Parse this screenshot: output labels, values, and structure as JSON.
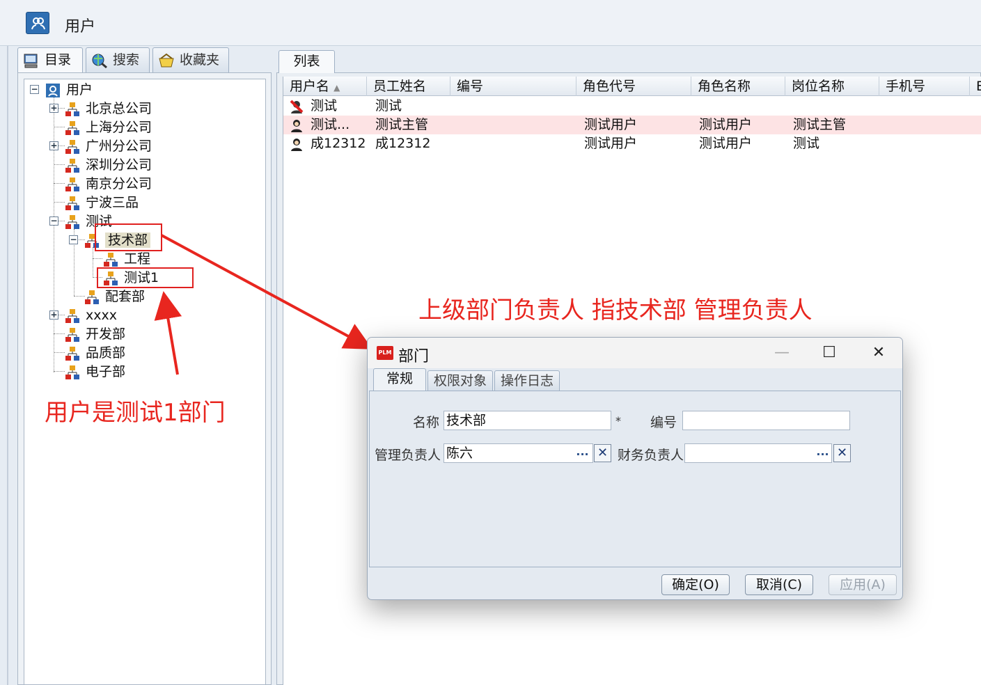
{
  "window": {
    "title": "用户"
  },
  "left_panel": {
    "tabs": [
      {
        "label": "目录",
        "icon": "computer-icon"
      },
      {
        "label": "搜索",
        "icon": "search-globe-icon"
      },
      {
        "label": "收藏夹",
        "icon": "favorites-icon"
      }
    ],
    "tree": {
      "root": "用户",
      "items": [
        "北京总公司",
        "上海分公司",
        "广州分公司",
        "深圳分公司",
        "南京分公司",
        "宁波三品",
        "测试",
        "技术部",
        "工程",
        "测试1",
        "配套部",
        "xxxx",
        "开发部",
        "品质部",
        "电子部"
      ]
    }
  },
  "right_panel": {
    "tab": "列表",
    "columns": [
      "用户名",
      "员工姓名",
      "编号",
      "角色代号",
      "角色名称",
      "岗位名称",
      "手机号",
      "E"
    ],
    "rows": [
      {
        "username": "测试",
        "employee": "测试",
        "number": "",
        "role_code": "",
        "role_name": "",
        "post": "",
        "phone": ""
      },
      {
        "username": "测试...",
        "employee": "测试主管",
        "number": "",
        "role_code": "测试用户",
        "role_name": "测试用户",
        "post": "测试主管",
        "phone": ""
      },
      {
        "username": "成12312",
        "employee": "成12312",
        "number": "",
        "role_code": "测试用户",
        "role_name": "测试用户",
        "post": "测试",
        "phone": ""
      }
    ]
  },
  "annotations": {
    "top": "上级部门负责人 指技术部 管理负责人",
    "bottom": "用户是测试1部门"
  },
  "dialog": {
    "title": "部门",
    "tabs": [
      "常规",
      "权限对象",
      "操作日志"
    ],
    "fields": {
      "name_label": "名称",
      "name_value": "技术部",
      "required_mark": "*",
      "code_label": "编号",
      "code_value": "",
      "manager_label": "管理负责人",
      "manager_value": "陈六",
      "finance_label": "财务负责人",
      "finance_value": "",
      "browse": "...",
      "clear": "✕"
    },
    "buttons": {
      "ok": "确定(O)",
      "cancel": "取消(C)",
      "apply": "应用(A)"
    }
  },
  "colors": {
    "annotation": "#e8261f",
    "highlight_row": "#fde3e4",
    "selected_node": "#e2dfc9"
  }
}
